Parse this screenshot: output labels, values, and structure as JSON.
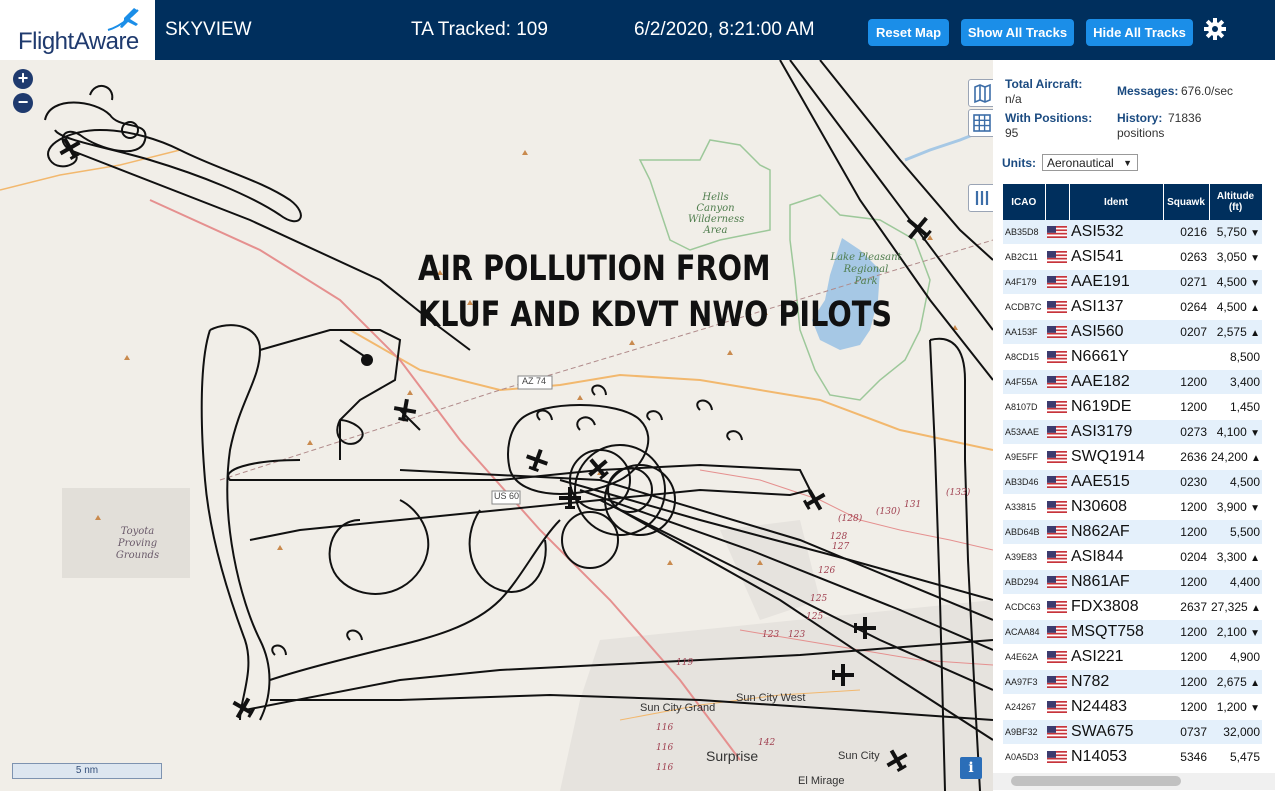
{
  "header": {
    "logo": "FlightAware",
    "app_name": "SKYVIEW",
    "tracked": "TA Tracked: 109",
    "datetime": "6/2/2020, 8:21:00 AM",
    "reset_label": "Reset Map",
    "show_all_label": "Show All Tracks",
    "hide_all_label": "Hide All Tracks"
  },
  "map": {
    "zoom_in": "+",
    "zoom_out": "−",
    "overlay_line1": "AIR POLLUTION FROM",
    "overlay_line2": "KLUF AND KDVT NWO PILOTS",
    "scale": "5 nm",
    "info": "i",
    "labels": {
      "hells_canyon": [
        "Hells Canyon",
        "Wilderness",
        "Area"
      ],
      "lake_pleasant": [
        "Lake Pleasant",
        "Regional",
        "Park"
      ],
      "toyota": [
        "Toyota",
        "Proving",
        "Grounds"
      ],
      "az74": "AZ 74",
      "sun_city_west": "Sun City West",
      "sun_city_grand": "Sun City Grand",
      "surprise": "Surprise",
      "sun_city": "Sun City",
      "el_mirage": "El Mirage",
      "us60": "US 60",
      "r119": "119",
      "r116a": "116",
      "r116b": "116",
      "r116c": "116",
      "r142": "142",
      "r123a": "123",
      "r123b": "123",
      "r125a": "125",
      "r125b": "125",
      "r126": "126",
      "r127": "127",
      "r128a": "(128)",
      "r128b": "128",
      "r130": "(130)",
      "r131": "131",
      "r133": "(133)"
    }
  },
  "stats": {
    "total_aircraft_label": "Total Aircraft:",
    "total_aircraft": "n/a",
    "with_positions_label": "With Positions:",
    "with_positions": "95",
    "messages_label": "Messages:",
    "messages": "676.0/sec",
    "history_label": "History:",
    "history": "71836",
    "history_unit": "positions"
  },
  "units": {
    "label": "Units:",
    "selected": "Aeronautical"
  },
  "table": {
    "headers": {
      "icao": "ICAO",
      "ident": "Ident",
      "squawk": "Squawk",
      "altitude": "Altitude",
      "altitude_unit": "(ft)"
    },
    "rows": [
      {
        "icao": "AB35D8",
        "ident": "ASI532",
        "squawk": "0216",
        "altitude": "5,750",
        "trend": "▼"
      },
      {
        "icao": "AB2C11",
        "ident": "ASI541",
        "squawk": "0263",
        "altitude": "3,050",
        "trend": "▼"
      },
      {
        "icao": "A4F179",
        "ident": "AAE191",
        "squawk": "0271",
        "altitude": "4,500",
        "trend": "▼"
      },
      {
        "icao": "ACDB7C",
        "ident": "ASI137",
        "squawk": "0264",
        "altitude": "4,500",
        "trend": "▲"
      },
      {
        "icao": "AA153F",
        "ident": "ASI560",
        "squawk": "0207",
        "altitude": "2,575",
        "trend": "▲"
      },
      {
        "icao": "A8CD15",
        "ident": "N6661Y",
        "squawk": "",
        "altitude": "8,500",
        "trend": ""
      },
      {
        "icao": "A4F55A",
        "ident": "AAE182",
        "squawk": "1200",
        "altitude": "3,400",
        "trend": ""
      },
      {
        "icao": "A8107D",
        "ident": "N619DE",
        "squawk": "1200",
        "altitude": "1,450",
        "trend": ""
      },
      {
        "icao": "A53AAE",
        "ident": "ASI3179",
        "squawk": "0273",
        "altitude": "4,100",
        "trend": "▼"
      },
      {
        "icao": "A9E5FF",
        "ident": "SWQ1914",
        "squawk": "2636",
        "altitude": "24,200",
        "trend": "▲"
      },
      {
        "icao": "AB3D46",
        "ident": "AAE515",
        "squawk": "0230",
        "altitude": "4,500",
        "trend": ""
      },
      {
        "icao": "A33815",
        "ident": "N30608",
        "squawk": "1200",
        "altitude": "3,900",
        "trend": "▼"
      },
      {
        "icao": "ABD64B",
        "ident": "N862AF",
        "squawk": "1200",
        "altitude": "5,500",
        "trend": ""
      },
      {
        "icao": "A39E83",
        "ident": "ASI844",
        "squawk": "0204",
        "altitude": "3,300",
        "trend": "▲"
      },
      {
        "icao": "ABD294",
        "ident": "N861AF",
        "squawk": "1200",
        "altitude": "4,400",
        "trend": ""
      },
      {
        "icao": "ACDC63",
        "ident": "FDX3808",
        "squawk": "2637",
        "altitude": "27,325",
        "trend": "▲"
      },
      {
        "icao": "ACAA84",
        "ident": "MSQT758",
        "squawk": "1200",
        "altitude": "2,100",
        "trend": "▼"
      },
      {
        "icao": "A4E62A",
        "ident": "ASI221",
        "squawk": "1200",
        "altitude": "4,900",
        "trend": ""
      },
      {
        "icao": "AA97F3",
        "ident": "N782",
        "squawk": "1200",
        "altitude": "2,675",
        "trend": "▲"
      },
      {
        "icao": "A24267",
        "ident": "N24483",
        "squawk": "1200",
        "altitude": "1,200",
        "trend": "▼"
      },
      {
        "icao": "A9BF32",
        "ident": "SWA675",
        "squawk": "0737",
        "altitude": "32,000",
        "trend": ""
      },
      {
        "icao": "A0A5D3",
        "ident": "N14053",
        "squawk": "5346",
        "altitude": "5,475",
        "trend": ""
      }
    ]
  },
  "colors": {
    "header_bg": "#002f5d",
    "button_blue": "#1b8ee8",
    "row_alt": "#e4f0fb",
    "track": "#111111"
  }
}
